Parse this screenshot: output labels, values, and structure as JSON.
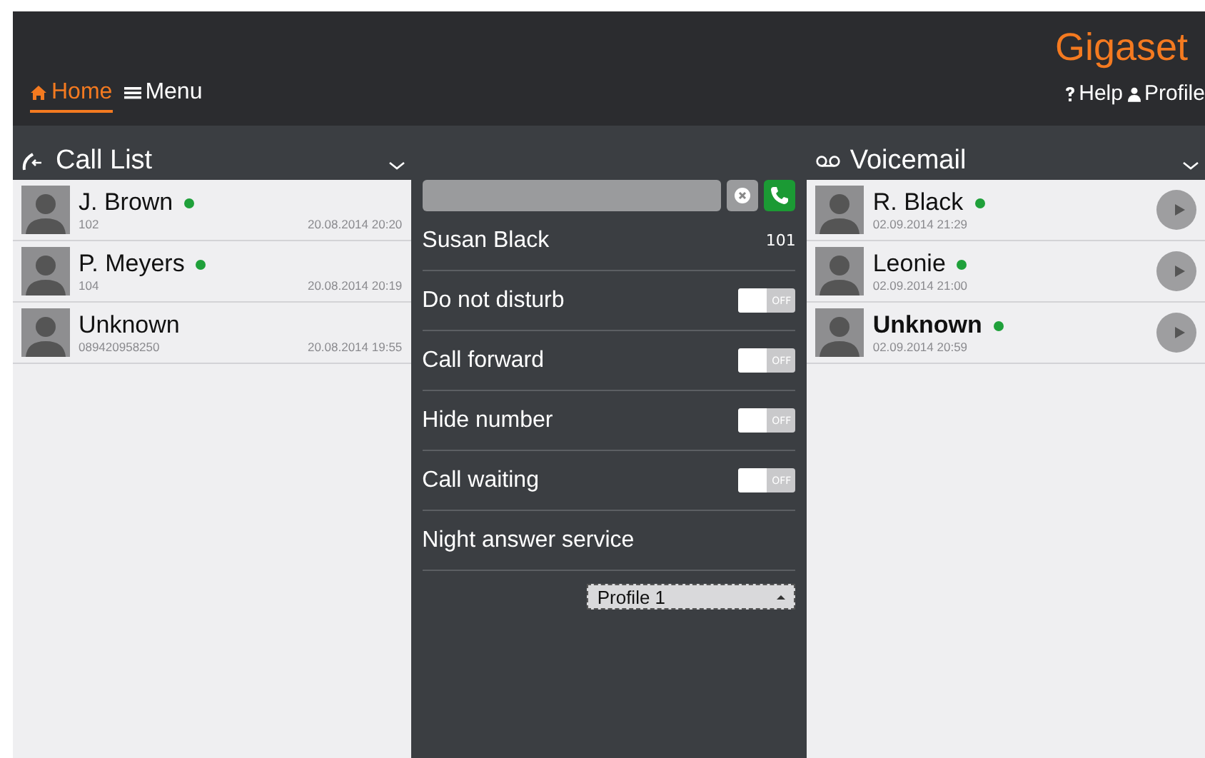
{
  "header": {
    "logo": "Gigaset",
    "nav": [
      {
        "label": "Home",
        "selected": true
      },
      {
        "label": "Menu",
        "selected": false
      }
    ],
    "links": [
      "Help",
      "Profile"
    ]
  },
  "call_list": {
    "title": "Call List",
    "items": [
      {
        "name": "J. Brown",
        "online": true,
        "number": "102",
        "time": "20.08.2014 20:20"
      },
      {
        "name": "P. Meyers",
        "online": true,
        "number": "104",
        "time": "20.08.2014 20:19"
      },
      {
        "name": "Unknown",
        "online": false,
        "number": "089420958250",
        "time": "20.08.2014 19:55"
      }
    ]
  },
  "settings": {
    "user": {
      "name": "Susan Black",
      "extension": "101"
    },
    "toggles": [
      {
        "label": "Do not disturb",
        "on": false,
        "state_text": "OFF"
      },
      {
        "label": "Call forward",
        "on": false,
        "state_text": "OFF"
      },
      {
        "label": "Hide number",
        "on": false,
        "state_text": "OFF"
      },
      {
        "label": "Call waiting",
        "on": false,
        "state_text": "OFF"
      }
    ],
    "night_service": {
      "label": "Night answer service",
      "profile": "Profile 1"
    }
  },
  "voicemail": {
    "title": "Voicemail",
    "items": [
      {
        "name": "R. Black",
        "online": true,
        "unread": false,
        "time": "02.09.2014 21:29"
      },
      {
        "name": "Leonie",
        "online": true,
        "unread": false,
        "time": "02.09.2014 21:00"
      },
      {
        "name": "Unknown",
        "online": true,
        "unread": true,
        "time": "02.09.2014 20:59"
      }
    ]
  }
}
